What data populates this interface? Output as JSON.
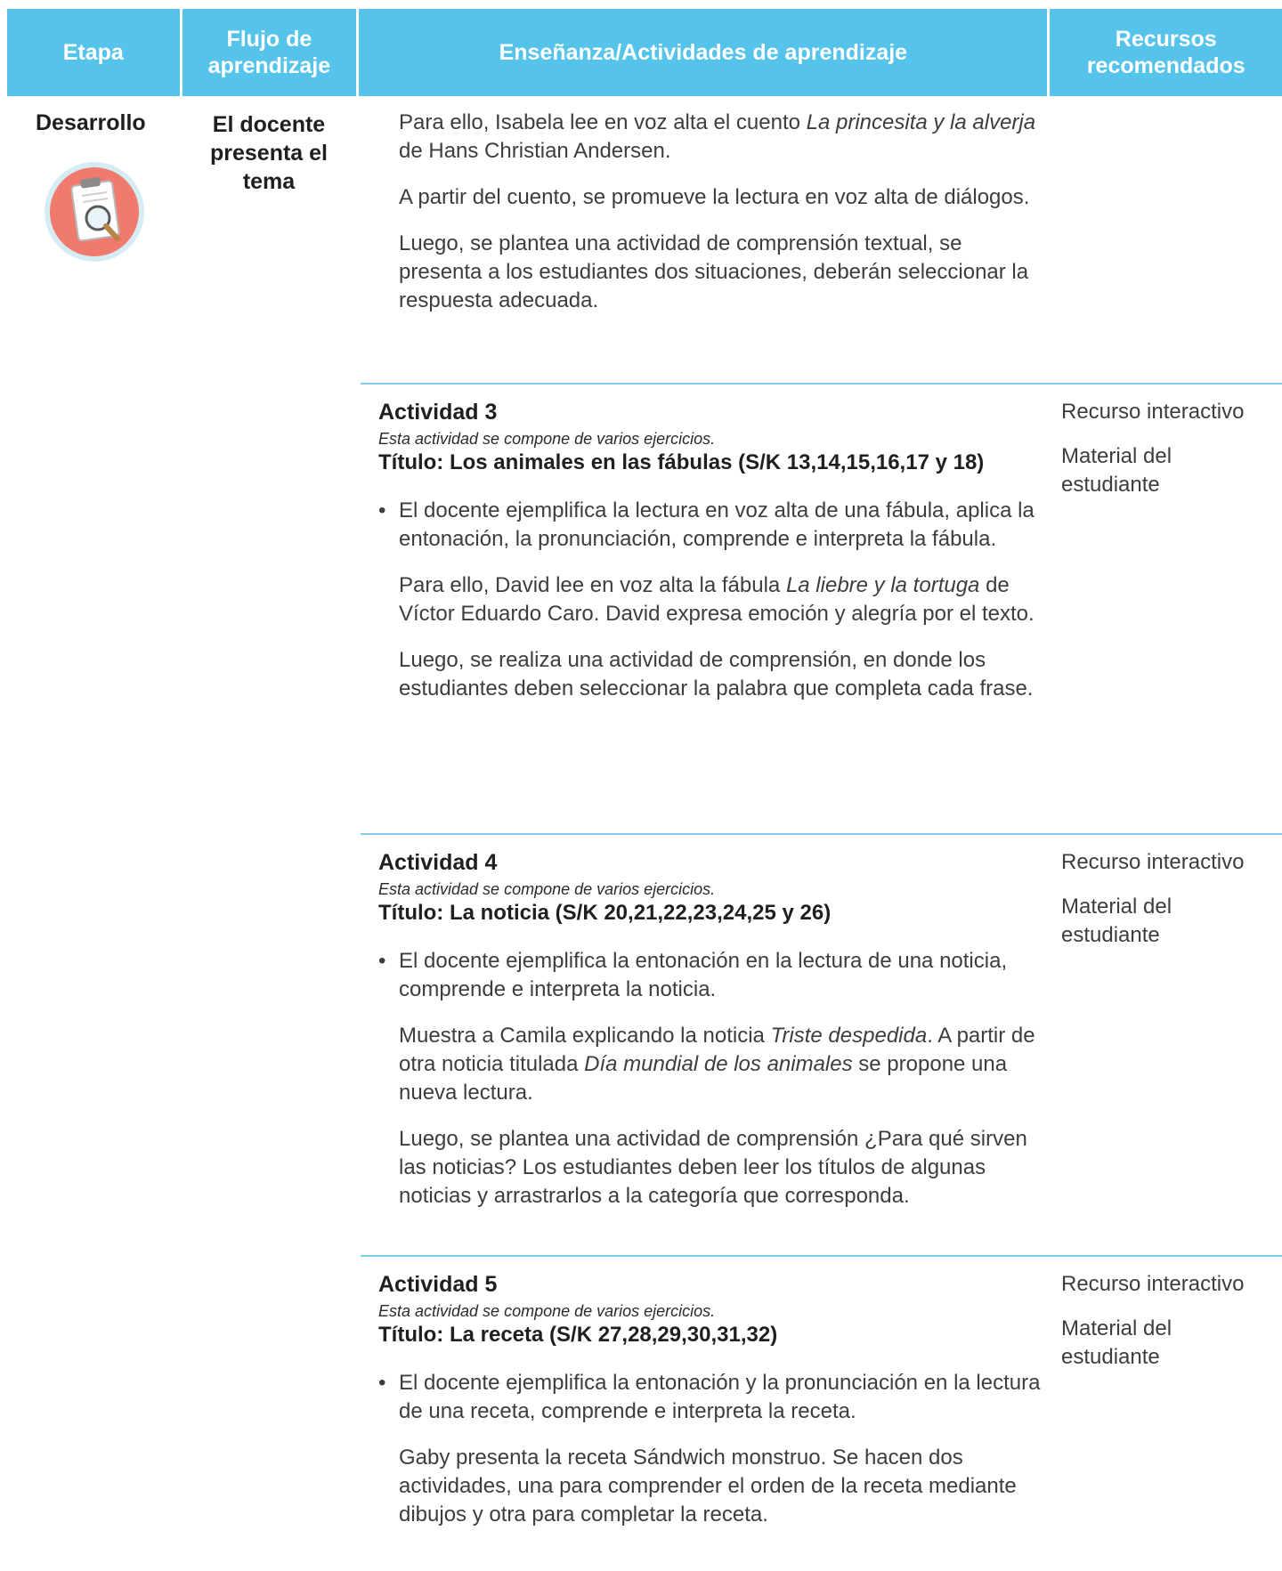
{
  "header": {
    "etapa": "Etapa",
    "flujo": "Flujo de aprendizaje",
    "ensenanza": "Enseñanza/Actividades de aprendizaje",
    "recursos": "Recursos recomendados"
  },
  "stage": {
    "etapa": "Desarrollo",
    "flujo": "El docente presenta el tema",
    "icon": "clipboard-magnifier-icon",
    "icon_bg": "#f07a6e"
  },
  "intro": {
    "p1_a": "Para ello, Isabela lee en voz alta el cuento ",
    "p1_em": "La princesita y la alverja",
    "p1_b": " de Hans Christian Andersen.",
    "p2": "A partir del cuento, se promueve la lectura en voz alta de diálogos.",
    "p3": "Luego, se plantea una actividad de comprensión textual, se presenta a los estudiantes dos situaciones, deberán seleccionar la respuesta adecuada."
  },
  "activities": [
    {
      "title": "Actividad 3",
      "note": "Esta actividad se compone de varios ejercicios.",
      "subtitle": "Título: Los animales en las fábulas (S/K 13,14,15,16,17 y 18)",
      "bullet": "El docente ejemplifica la lectura en voz alta de una fábula, aplica la entonación, la pronunciación, comprende e interpreta la fábula.",
      "p1_a": "Para ello, David lee en voz alta la fábula ",
      "p1_em": "La liebre y la tortuga",
      "p1_b": " de Víctor Eduardo Caro. David expresa emoción y alegría por el texto.",
      "p2": "Luego, se realiza una actividad de comprensión, en donde los estudiantes deben seleccionar la palabra que completa cada frase.",
      "resources": [
        "Recurso interactivo",
        "Material del estudiante"
      ]
    },
    {
      "title": "Actividad 4",
      "note": "Esta actividad se compone de varios ejercicios.",
      "subtitle": "Título: La noticia (S/K 20,21,22,23,24,25 y 26)",
      "bullet": "El docente ejemplifica la entonación en la lectura de una noticia, comprende e interpreta la noticia.",
      "p1_a": "Muestra a Camila explicando la noticia ",
      "p1_em": "Triste despedida",
      "p1_b": ". A partir de otra noticia titulada ",
      "p1_em2": "Día mundial de los animales",
      "p1_c": " se propone una nueva lectura.",
      "p2": "Luego, se plantea una actividad de comprensión ¿Para qué sirven las noticias? Los estudiantes deben leer los títulos de algunas noticias y arrastrarlos a la categoría que corresponda.",
      "resources": [
        "Recurso interactivo",
        "Material del estudiante"
      ]
    },
    {
      "title": "Actividad 5",
      "note": "Esta actividad se compone de varios ejercicios.",
      "subtitle": "Título: La receta (S/K 27,28,29,30,31,32)",
      "bullet": "El docente ejemplifica la entonación y la pronunciación en la lectura de una receta, comprende e interpreta la receta.",
      "p1": "Gaby presenta la receta Sándwich monstruo. Se hacen dos actividades, una para comprender el orden de la receta mediante dibujos y otra para completar la receta.",
      "resources": [
        "Recurso interactivo",
        "Material del estudiante"
      ]
    }
  ],
  "colors": {
    "header": "#55c3ea",
    "separator": "#7ccbe8"
  }
}
